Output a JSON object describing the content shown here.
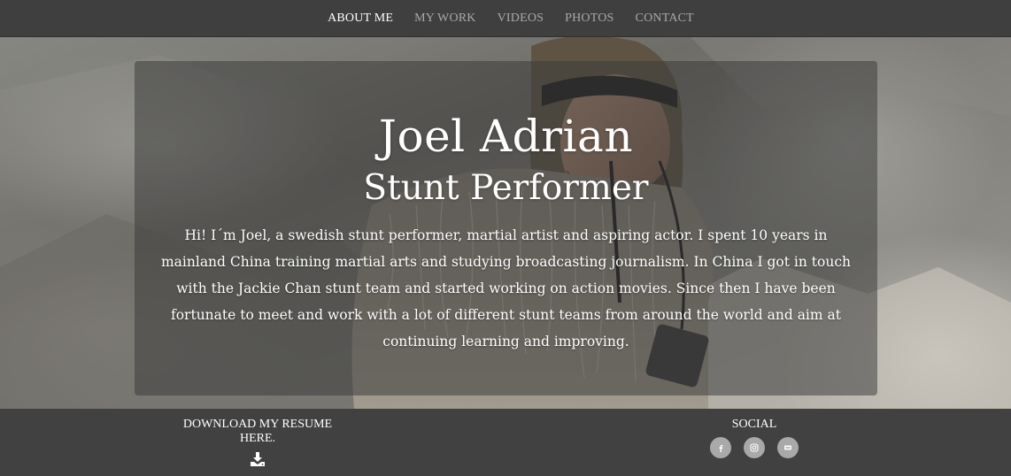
{
  "nav": {
    "items": [
      {
        "label": "ABOUT ME",
        "active": true
      },
      {
        "label": "MY WORK",
        "active": false
      },
      {
        "label": "VIDEOS",
        "active": false
      },
      {
        "label": "PHOTOS",
        "active": false
      },
      {
        "label": "CONTACT",
        "active": false
      }
    ]
  },
  "hero": {
    "name": "Joel Adrian",
    "role": "Stunt Performer",
    "bio": "Hi! I´m Joel, a swedish stunt performer, martial artist and aspiring actor. I spent 10 years in mainland China training martial arts and studying broadcasting journalism. In China I got in touch with the Jackie Chan stunt team and started working on action movies. Since then I have been fortunate to meet and work with a lot of different stunt teams from around the world and aim at continuing learning and improving."
  },
  "footer": {
    "resume_label": "DOWNLOAD MY RESUME HERE.",
    "social_label": "SOCIAL",
    "social_icons": [
      "facebook-icon",
      "instagram-icon",
      "imdb-icon"
    ]
  },
  "colors": {
    "nav_bg": "#3f3f3f",
    "footer_bg": "#414141",
    "nav_active": "#ffffff",
    "nav_inactive": "#a8a8a8",
    "social_button_bg": "#a9a9a9",
    "overlay": "rgba(58,58,58,0.52)"
  }
}
